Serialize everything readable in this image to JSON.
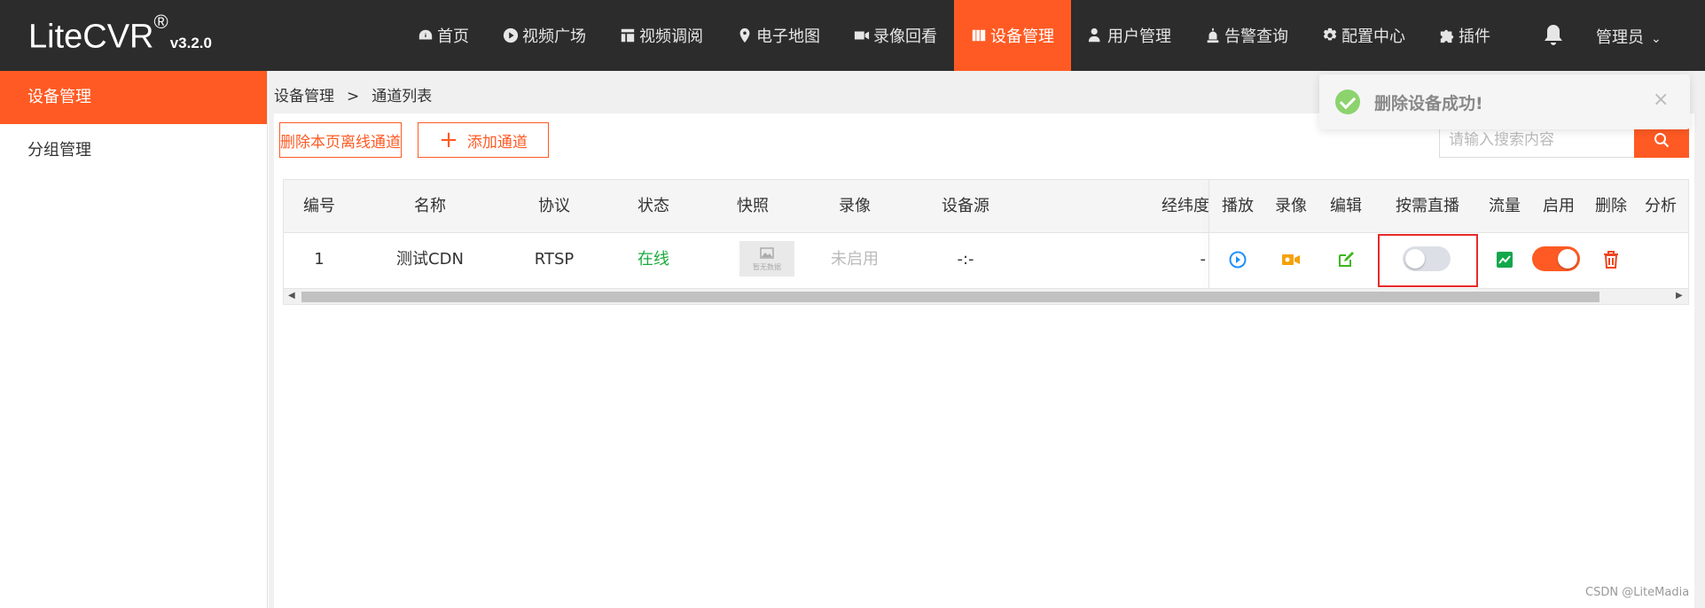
{
  "app": {
    "name": "LiteCVR",
    "reg": "®",
    "version": "v3.2.0"
  },
  "nav": [
    {
      "label": "首页",
      "icon": "dashboard-icon"
    },
    {
      "label": "视频广场",
      "icon": "play-circle-icon"
    },
    {
      "label": "视频调阅",
      "icon": "layout-icon"
    },
    {
      "label": "电子地图",
      "icon": "map-pin-icon"
    },
    {
      "label": "录像回看",
      "icon": "video-camera-icon"
    },
    {
      "label": "设备管理",
      "icon": "book-icon",
      "active": true
    },
    {
      "label": "用户管理",
      "icon": "user-gear-icon"
    },
    {
      "label": "告警查询",
      "icon": "alarm-icon"
    },
    {
      "label": "配置中心",
      "icon": "gear-icon"
    },
    {
      "label": "插件",
      "icon": "puzzle-icon"
    }
  ],
  "user": {
    "label": "管理员"
  },
  "sidebar": [
    {
      "label": "设备管理",
      "active": true
    },
    {
      "label": "分组管理",
      "active": false
    }
  ],
  "breadcrumb": {
    "first": "设备管理",
    "sep": ">",
    "second": "通道列表"
  },
  "actions": {
    "delete_offline": "删除本页离线通道",
    "add_channel_plus": "+",
    "add_channel": "添加通道"
  },
  "search": {
    "placeholder": "请输入搜索内容"
  },
  "toast": {
    "message": "删除设备成功!",
    "close": "×"
  },
  "table": {
    "headers": {
      "id": "编号",
      "name": "名称",
      "protocol": "协议",
      "status": "状态",
      "snapshot": "快照",
      "record": "录像",
      "source": "设备源",
      "latlng": "经纬度",
      "play": "播放",
      "rec": "录像",
      "edit": "编辑",
      "ondemand": "按需直播",
      "flow": "流量",
      "enable": "启用",
      "delete": "删除",
      "analysis": "分析"
    },
    "row": {
      "id": "1",
      "name": "测试CDN",
      "protocol": "RTSP",
      "status": "在线",
      "snapshot_text": "暂无数据",
      "record": "未启用",
      "source": "-:-",
      "latlng": "-",
      "ondemand_on": false,
      "enable_on": true
    }
  },
  "colors": {
    "accent": "#ff5a23",
    "online": "#1aab3c",
    "play": "#1e90ff",
    "rec": "#f5a10a",
    "edit": "#3cb81c",
    "flow": "#12a84a",
    "delete": "#f0441e"
  },
  "watermark": "CSDN @LiteMadia"
}
